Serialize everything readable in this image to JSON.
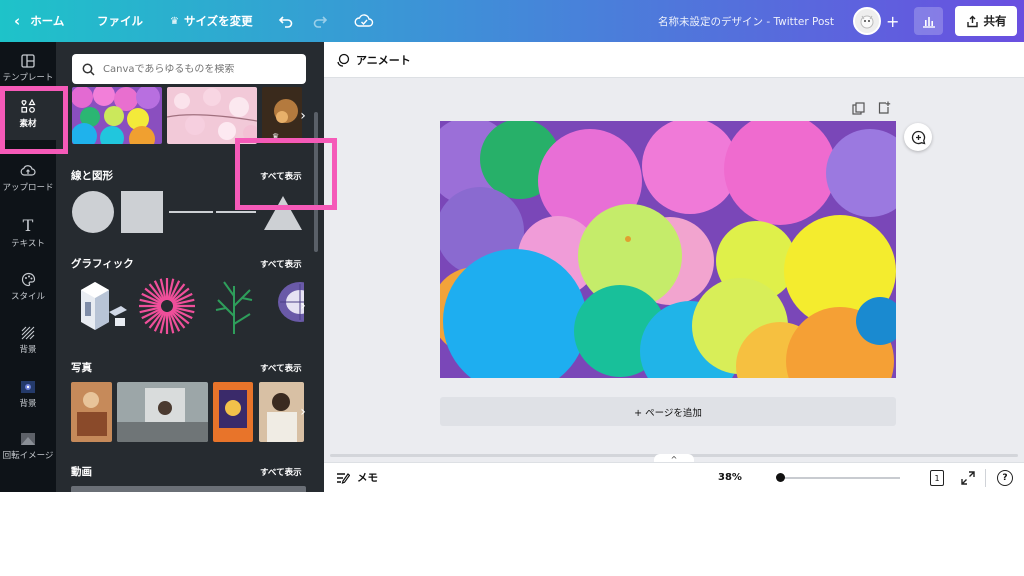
{
  "topbar": {
    "home_label": "ホーム",
    "file_label": "ファイル",
    "resize_label": "サイズを変更",
    "doc_title": "名称未設定のデザイン - Twitter Post",
    "share_label": "共有",
    "gradient_colors": [
      "#1ec3c9",
      "#3f8fd8",
      "#6a4fe0"
    ]
  },
  "rail": {
    "items": [
      {
        "label": "テンプレート",
        "icon": "template-icon"
      },
      {
        "label": "素材",
        "icon": "elements-icon",
        "active": true
      },
      {
        "label": "アップロード",
        "icon": "upload-cloud-icon"
      },
      {
        "label": "テキスト",
        "icon": "text-icon"
      },
      {
        "label": "スタイル",
        "icon": "palette-icon"
      },
      {
        "label": "背景",
        "icon": "background-icon"
      },
      {
        "label": "背景",
        "icon": "background-image-icon"
      },
      {
        "label": "回転イメージ",
        "icon": "image-icon"
      }
    ]
  },
  "panel": {
    "search_placeholder": "Canvaであらゆるものを検索",
    "sections": [
      {
        "title": "線と図形",
        "see_all": "すべて表示"
      },
      {
        "title": "グラフィック",
        "see_all": "すべて表示"
      },
      {
        "title": "写真",
        "see_all": "すべて表示"
      },
      {
        "title": "動画",
        "see_all": "すべて表示"
      }
    ]
  },
  "editor": {
    "animate_label": "アニメート",
    "add_page_label": "+ ページを追加",
    "notes_label": "メモ",
    "zoom": "38%",
    "zoom_fraction": 0.0,
    "page_count": "1",
    "help_label": "?"
  },
  "colors": {
    "accent": "#7d2ae8",
    "highlight": "#f55ab8",
    "panel_bg": "#262b30",
    "rail_bg": "#0e1318",
    "editor_bg": "#ebecf0"
  }
}
